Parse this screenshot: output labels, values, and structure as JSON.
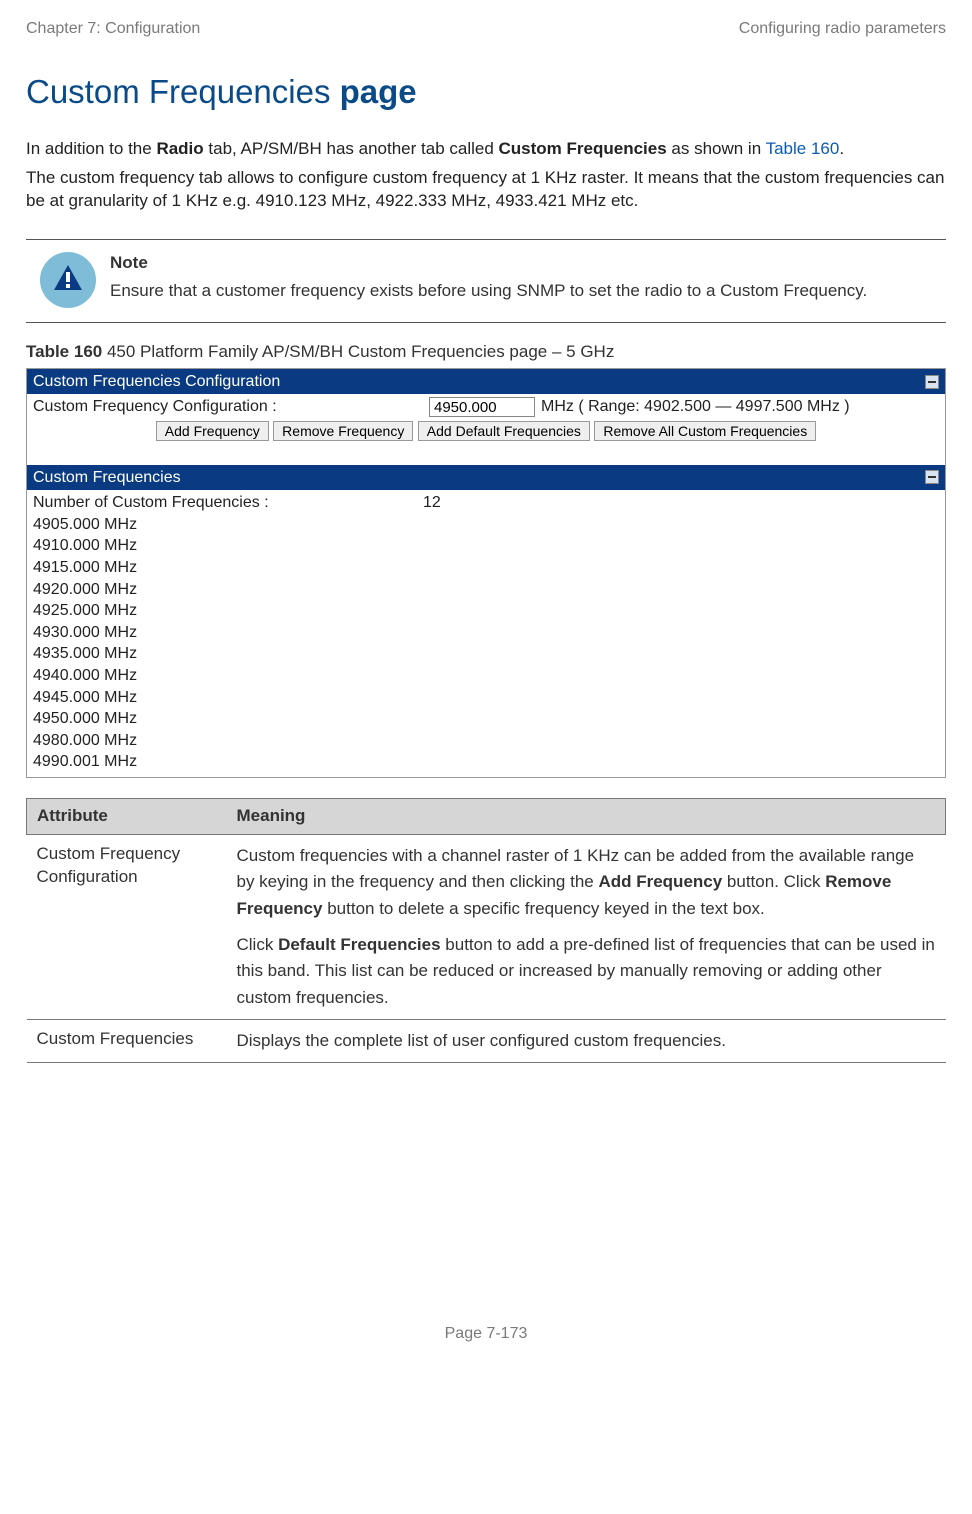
{
  "header": {
    "left": "Chapter 7:  Configuration",
    "right": "Configuring radio parameters"
  },
  "title": {
    "part1": "Custom Frequencies ",
    "part2": "page"
  },
  "para1_a": "In addition to the ",
  "para1_bold1": "Radio",
  "para1_b": " tab, AP/SM/BH has another tab called ",
  "para1_bold2": "Custom Frequencies",
  "para1_c": " as shown in ",
  "para1_link": "Table 160",
  "para1_d": ".",
  "para2": "The custom frequency tab allows to configure custom frequency at 1 KHz raster. It means that the custom frequencies can be at granularity of 1 KHz e.g. 4910.123 MHz, 4922.333 MHz, 4933.421 MHz etc.",
  "note": {
    "label": "Note",
    "text": "Ensure that a customer frequency exists before using SNMP to set the radio to a Custom Frequency."
  },
  "caption": {
    "num": "Table 160",
    "text": " 450 Platform Family AP/SM/BH Custom Frequencies page – 5 GHz"
  },
  "panel1": {
    "title": "Custom Frequencies Configuration",
    "row_label": "Custom Frequency Configuration :",
    "input_value": "4950.000",
    "range_text": "MHz ( Range: 4902.500 — 4997.500 MHz )",
    "buttons": {
      "add": "Add Frequency",
      "remove": "Remove Frequency",
      "add_default": "Add Default Frequencies",
      "remove_all": "Remove All Custom Frequencies"
    }
  },
  "panel2": {
    "title": "Custom Frequencies",
    "count_label": "Number of Custom Frequencies :",
    "count_value": "12",
    "items": [
      "4905.000 MHz",
      "4910.000 MHz",
      "4915.000 MHz",
      "4920.000 MHz",
      "4925.000 MHz",
      "4930.000 MHz",
      "4935.000 MHz",
      "4940.000 MHz",
      "4945.000 MHz",
      "4950.000 MHz",
      "4980.000 MHz",
      "4990.001 MHz"
    ]
  },
  "attr_table": {
    "h1": "Attribute",
    "h2": "Meaning",
    "rows": [
      {
        "attr": "Custom Frequency Configuration",
        "p1_a": "Custom frequencies with a channel raster of 1 KHz can be added from the available range by keying in the frequency and then clicking the ",
        "p1_b1": "Add Frequency",
        "p1_b": " button. Click ",
        "p1_b2": "Remove Frequency",
        "p1_c": " button to delete a specific frequency keyed in the text box.",
        "p2_a": "Click ",
        "p2_b1": "Default Frequencies",
        "p2_b": " button to add a pre-defined list of frequencies that can be used in this band. This list can be reduced or increased by manually removing or adding other custom frequencies."
      },
      {
        "attr": "Custom Frequencies",
        "p1": "Displays the complete list of user configured custom frequencies."
      }
    ]
  },
  "footer": "Page 7-173"
}
